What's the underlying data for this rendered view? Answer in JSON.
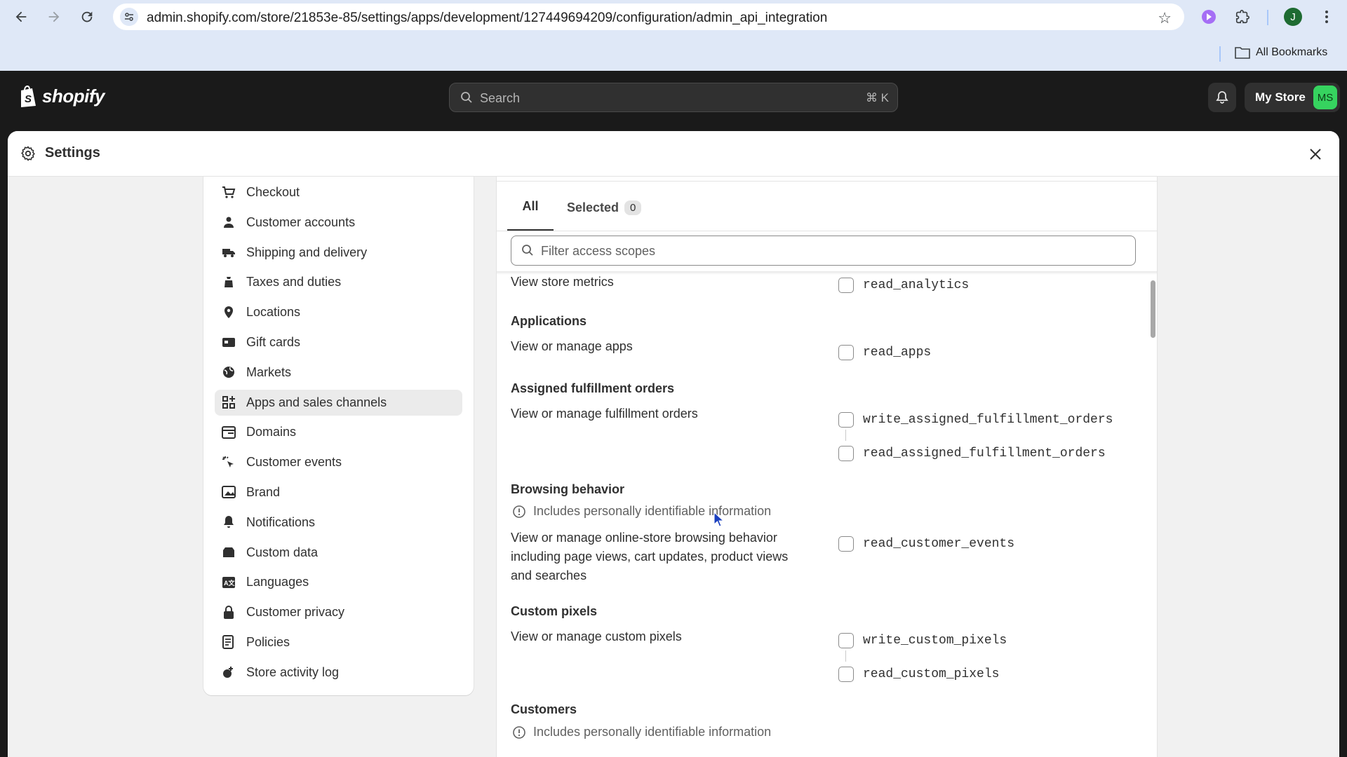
{
  "browser": {
    "url": "admin.shopify.com/store/21853e-85/settings/apps/development/127449694209/configuration/admin_api_integration",
    "bookmarks_label": "All Bookmarks",
    "profile_initial": "J"
  },
  "topbar": {
    "logo_text": "shopify",
    "search_placeholder": "Search",
    "search_shortcut": "⌘ K",
    "store_name": "My Store",
    "store_initials": "MS"
  },
  "settings": {
    "title": "Settings",
    "nav": [
      {
        "label": "Checkout",
        "icon": "cart-icon"
      },
      {
        "label": "Customer accounts",
        "icon": "person-icon"
      },
      {
        "label": "Shipping and delivery",
        "icon": "truck-icon"
      },
      {
        "label": "Taxes and duties",
        "icon": "tax-icon"
      },
      {
        "label": "Locations",
        "icon": "location-pin-icon"
      },
      {
        "label": "Gift cards",
        "icon": "gift-card-icon"
      },
      {
        "label": "Markets",
        "icon": "globe-icon"
      },
      {
        "label": "Apps and sales channels",
        "icon": "apps-icon",
        "active": true
      },
      {
        "label": "Domains",
        "icon": "domain-icon"
      },
      {
        "label": "Customer events",
        "icon": "click-icon"
      },
      {
        "label": "Brand",
        "icon": "brand-icon"
      },
      {
        "label": "Notifications",
        "icon": "bell-icon"
      },
      {
        "label": "Custom data",
        "icon": "database-icon"
      },
      {
        "label": "Languages",
        "icon": "translate-icon"
      },
      {
        "label": "Customer privacy",
        "icon": "lock-icon"
      },
      {
        "label": "Policies",
        "icon": "policy-icon"
      },
      {
        "label": "Store activity log",
        "icon": "activity-log-icon"
      }
    ]
  },
  "scopes_panel": {
    "tab_all": "All",
    "tab_selected": "Selected",
    "selected_count": "0",
    "filter_placeholder": "Filter access scopes",
    "pii_warning": "Includes personally identifiable information",
    "groups": {
      "analytics": {
        "description": "View store metrics",
        "scopes": [
          "read_analytics"
        ]
      },
      "applications": {
        "title": "Applications",
        "description": "View or manage apps",
        "scopes": [
          "read_apps"
        ]
      },
      "assigned_fulfillment": {
        "title": "Assigned fulfillment orders",
        "description": "View or manage fulfillment orders",
        "scopes": [
          "write_assigned_fulfillment_orders",
          "read_assigned_fulfillment_orders"
        ]
      },
      "browsing": {
        "title": "Browsing behavior",
        "description_lines": [
          "View or manage online-store browsing behavior",
          "including page views, cart updates, product views",
          "and searches"
        ],
        "scopes": [
          "read_customer_events"
        ]
      },
      "custom_pixels": {
        "title": "Custom pixels",
        "description": "View or manage custom pixels",
        "scopes": [
          "write_custom_pixels",
          "read_custom_pixels"
        ]
      },
      "customers": {
        "title": "Customers"
      }
    }
  }
}
